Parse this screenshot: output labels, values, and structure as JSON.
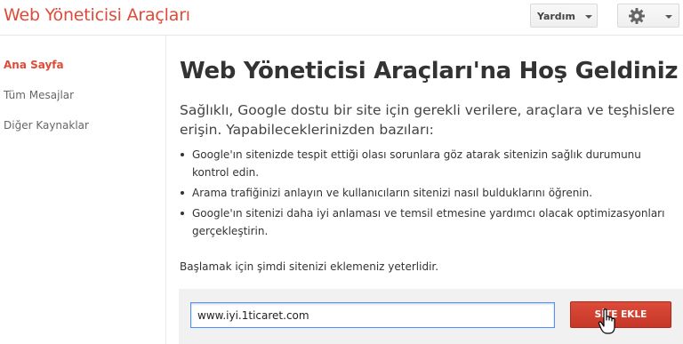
{
  "header": {
    "app_title": "Web Yöneticisi Araçları",
    "help_label": "Yardım",
    "help_icon": "chevron-down-icon",
    "settings_icon": "gear-icon"
  },
  "sidebar": {
    "items": [
      {
        "label": "Ana Sayfa",
        "active": true
      },
      {
        "label": "Tüm Mesajlar",
        "active": false
      },
      {
        "label": "Diğer Kaynaklar",
        "active": false
      }
    ]
  },
  "main": {
    "heading": "Web Yöneticisi Araçları'na Hoş Geldiniz",
    "intro": "Sağlıklı, Google dostu bir site için gerekli verilere, araçlara ve teşhislere erişin. Yapabileceklerinizden bazıları:",
    "bullets": [
      "Google'ın sitenizde tespit ettiği olası sorunlara göz atarak sitenizin sağlık durumunu kontrol edin.",
      "Arama trafiğinizi anlayın ve kullanıcıların sitenizi nasıl bulduklarını öğrenin.",
      "Google'ın sitenizi daha iyi anlaması ve temsil etmesine yardımcı olacak optimizasyonları gerçekleştirin."
    ],
    "start_text": "Başlamak için şimdi sitenizi eklemeniz yeterlidir.",
    "site_input_value": "www.iyi.1ticaret.com",
    "add_site_label": "SİTE EKLE"
  },
  "colors": {
    "brand_red": "#dd4b39",
    "focus_blue": "#4d90fe"
  }
}
